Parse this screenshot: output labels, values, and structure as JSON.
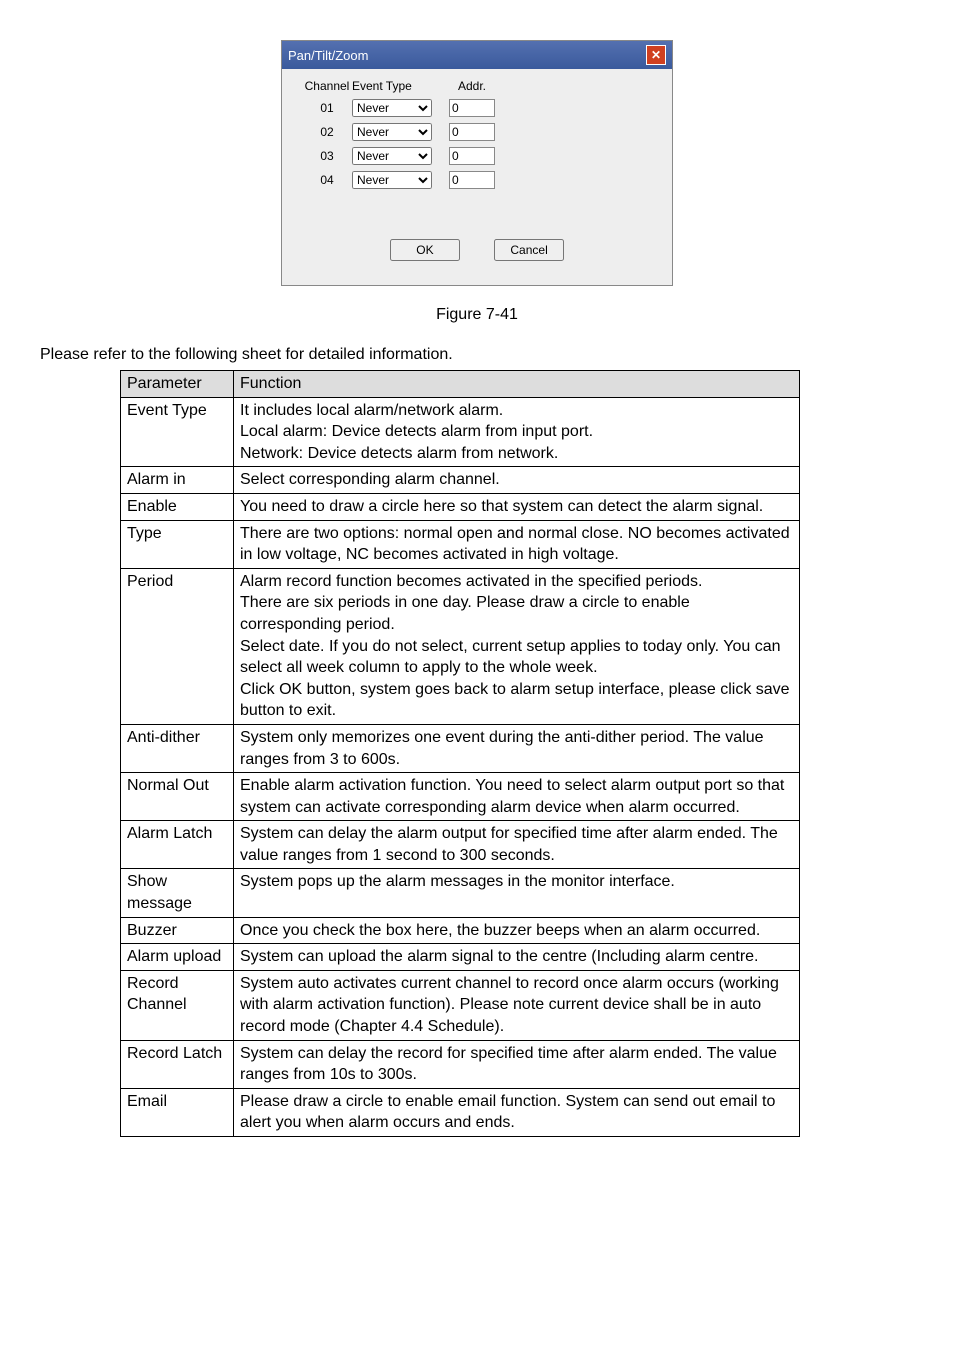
{
  "dialog": {
    "title": "Pan/Tilt/Zoom",
    "headers": {
      "channel": "Channel",
      "event": "Event Type",
      "addr": "Addr."
    },
    "rows": [
      {
        "ch": "01",
        "ev": "Never",
        "ad": "0"
      },
      {
        "ch": "02",
        "ev": "Never",
        "ad": "0"
      },
      {
        "ch": "03",
        "ev": "Never",
        "ad": "0"
      },
      {
        "ch": "04",
        "ev": "Never",
        "ad": "0"
      }
    ],
    "ok": "OK",
    "cancel": "Cancel"
  },
  "figure": "Figure 7-41",
  "lead": "Please refer to the following sheet for detailed information.",
  "th": {
    "param": "Parameter",
    "func": "Function"
  },
  "rows": [
    {
      "p": "Event Type",
      "f": "It includes local alarm/network alarm.\nLocal alarm: Device detects alarm from input port.\nNetwork: Device detects alarm from network."
    },
    {
      "p": "Alarm in",
      "f": "Select corresponding alarm channel."
    },
    {
      "p": "Enable",
      "f": "You need to draw a circle here so that system can detect the alarm signal."
    },
    {
      "p": "Type",
      "f": "There are two options: normal open and normal close. NO becomes activated in low voltage, NC becomes activated in high voltage."
    },
    {
      "p": "Period",
      "f": "Alarm record function becomes activated in the specified periods.\nThere are six periods in one day. Please draw a circle to enable corresponding period.\nSelect date. If you do not select, current setup applies to today only. You can select all week column to apply to the whole week.\nClick OK button, system goes back to alarm setup interface, please click save button to exit."
    },
    {
      "p": "Anti-dither",
      "f": "System only memorizes one event during the anti-dither period. The value ranges from 3 to 600s."
    },
    {
      "p": "Normal Out",
      "f": "Enable alarm activation function. You need to select alarm output port so that system can activate corresponding alarm device when alarm occurred."
    },
    {
      "p": "Alarm Latch",
      "f": "System can delay the alarm output for specified time after alarm ended. The value ranges from 1 second to 300 seconds."
    },
    {
      "p": "Show message",
      "f": "System pops up the alarm messages in the monitor interface."
    },
    {
      "p": "Buzzer",
      "f": "Once you check the box here, the buzzer beeps when an alarm occurred."
    },
    {
      "p": "Alarm upload",
      "f": "System can upload the alarm signal to the centre (Including alarm centre."
    },
    {
      "p": "Record Channel",
      "f": "System auto activates current channel to record once alarm occurs (working with alarm activation function). Please note current device shall be in auto record mode (Chapter 4.4 Schedule)."
    },
    {
      "p": "Record Latch",
      "f": "System can delay the record for specified time after alarm ended. The value ranges from 10s to 300s."
    },
    {
      "p": "Email",
      "f": "Please draw a circle to enable email function. System can send out email to alert you when alarm occurs and ends."
    }
  ]
}
